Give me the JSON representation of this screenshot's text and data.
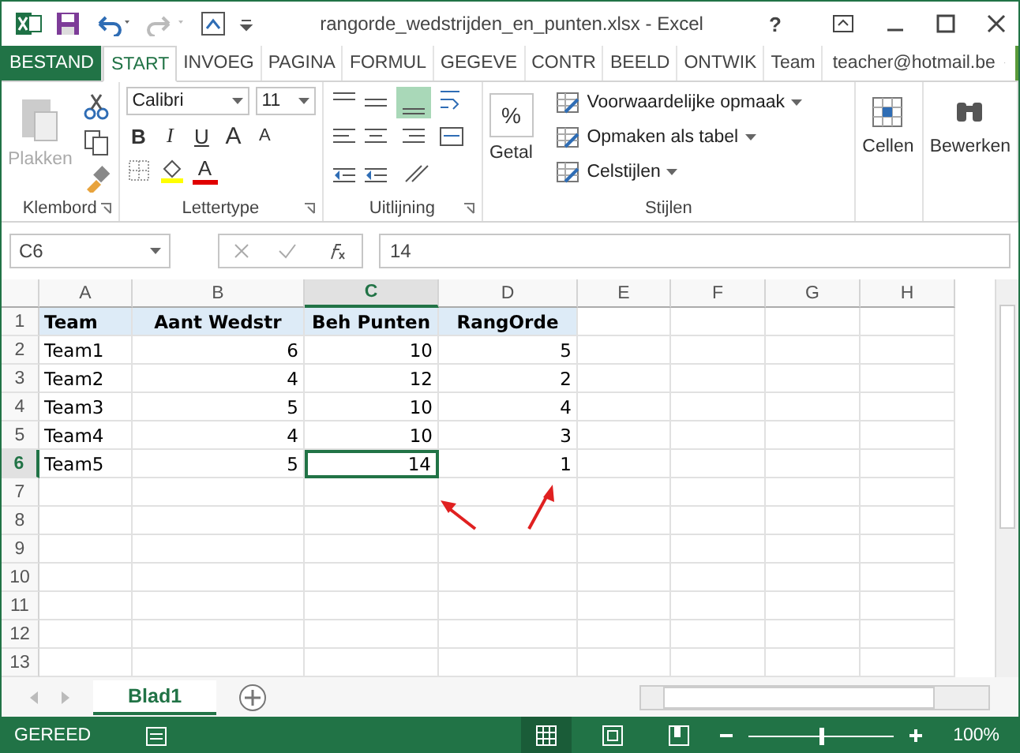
{
  "window": {
    "title": "rangorde_wedstrijden_en_punten.xlsx - Excel",
    "help": "?"
  },
  "tabs": [
    {
      "label": "BESTAND",
      "kind": "file",
      "selected": false
    },
    {
      "label": "START",
      "kind": "tab",
      "selected": true
    },
    {
      "label": "INVOEG",
      "kind": "tab",
      "selected": false
    },
    {
      "label": "PAGINA",
      "kind": "tab",
      "selected": false
    },
    {
      "label": "FORMUL",
      "kind": "tab",
      "selected": false
    },
    {
      "label": "GEGEVE",
      "kind": "tab",
      "selected": false
    },
    {
      "label": "CONTR",
      "kind": "tab",
      "selected": false
    },
    {
      "label": "BEELD",
      "kind": "tab",
      "selected": false
    },
    {
      "label": "ONTWIK",
      "kind": "tab",
      "selected": false
    },
    {
      "label": "Team",
      "kind": "tab",
      "selected": false
    }
  ],
  "account": "teacher@hotmail.be",
  "ribbon": {
    "paste": "Plakken",
    "font": "Calibri",
    "size": "11",
    "format_buttons": [
      {
        "label": "B",
        "kind": "bold"
      },
      {
        "label": "I",
        "kind": "italic"
      },
      {
        "label": "U",
        "kind": "underline"
      }
    ],
    "grow_labels": [
      "A",
      "A"
    ],
    "font_color_label": "A",
    "styles": [
      "Voorwaardelijke opmaak",
      "Opmaken als tabel",
      "Celstijlen"
    ],
    "number": "Getal",
    "number_symbol": "%",
    "cells": "Cellen",
    "edit": "Bewerken",
    "groups": [
      {
        "label": "Klembord",
        "launcher": true
      },
      {
        "label": "Lettertype",
        "launcher": true
      },
      {
        "label": "Uitlijning",
        "launcher": true
      },
      {
        "label": "Stijlen",
        "launcher": false
      }
    ]
  },
  "formula_bar": {
    "name_box": "C6",
    "value": "14"
  },
  "columns": [
    {
      "label": "A",
      "selected": false
    },
    {
      "label": "B",
      "selected": false
    },
    {
      "label": "C",
      "selected": true
    },
    {
      "label": "D",
      "selected": false
    },
    {
      "label": "E",
      "selected": false
    },
    {
      "label": "F",
      "selected": false
    },
    {
      "label": "G",
      "selected": false
    },
    {
      "label": "H",
      "selected": false
    }
  ],
  "rows": [
    {
      "number": "1",
      "selected": false,
      "header": true,
      "cells": [
        {
          "text": "Team",
          "selected": false
        },
        {
          "text": "Aant Wedstr",
          "selected": false
        },
        {
          "text": "Beh Punten",
          "selected": false
        },
        {
          "text": "RangOrde",
          "selected": false
        }
      ]
    },
    {
      "number": "2",
      "selected": false,
      "header": false,
      "cells": [
        {
          "text": "Team1",
          "selected": false
        },
        {
          "text": "6",
          "selected": false
        },
        {
          "text": "10",
          "selected": false
        },
        {
          "text": "5",
          "selected": false
        }
      ]
    },
    {
      "number": "3",
      "selected": false,
      "header": false,
      "cells": [
        {
          "text": "Team2",
          "selected": false
        },
        {
          "text": "4",
          "selected": false
        },
        {
          "text": "12",
          "selected": false
        },
        {
          "text": "2",
          "selected": false
        }
      ]
    },
    {
      "number": "4",
      "selected": false,
      "header": false,
      "cells": [
        {
          "text": "Team3",
          "selected": false
        },
        {
          "text": "5",
          "selected": false
        },
        {
          "text": "10",
          "selected": false
        },
        {
          "text": "4",
          "selected": false
        }
      ]
    },
    {
      "number": "5",
      "selected": false,
      "header": false,
      "cells": [
        {
          "text": "Team4",
          "selected": false
        },
        {
          "text": "4",
          "selected": false
        },
        {
          "text": "10",
          "selected": false
        },
        {
          "text": "3",
          "selected": false
        }
      ]
    },
    {
      "number": "6",
      "selected": true,
      "header": false,
      "cells": [
        {
          "text": "Team5",
          "selected": false
        },
        {
          "text": "5",
          "selected": false
        },
        {
          "text": "14",
          "selected": true
        },
        {
          "text": "1",
          "selected": false
        }
      ]
    },
    {
      "number": "7",
      "selected": false
    },
    {
      "number": "8",
      "selected": false
    },
    {
      "number": "9",
      "selected": false
    },
    {
      "number": "10",
      "selected": false
    },
    {
      "number": "11",
      "selected": false
    },
    {
      "number": "12",
      "selected": false
    },
    {
      "number": "13",
      "selected": false
    }
  ],
  "sheets": [
    {
      "label": "Blad1",
      "selected": true
    }
  ],
  "status_bar": {
    "text": "GEREED",
    "zoom": "100%",
    "zoom_slider": {
      "level": 0.5
    },
    "views": [
      {
        "kind": "normal",
        "selected": true
      },
      {
        "kind": "layout",
        "selected": false
      },
      {
        "kind": "pagebreak",
        "selected": false
      }
    ]
  }
}
